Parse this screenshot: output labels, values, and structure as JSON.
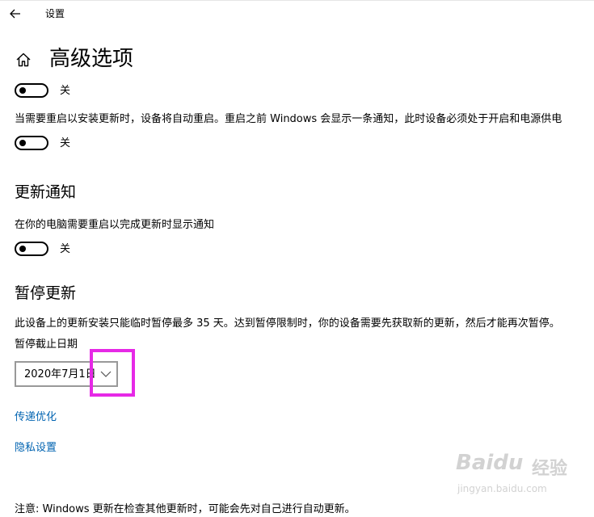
{
  "window": {
    "app_title": "设置",
    "back_icon": "arrow-left-icon"
  },
  "page": {
    "home_icon": "home-icon",
    "title": "高级选项"
  },
  "toggles": {
    "first": {
      "state_label": "关",
      "on": false
    },
    "restart": {
      "description": "当需要重启以安装更新时，设备将自动重启。重启之前 Windows 会显示一条通知，此时设备必须处于开启和电源供电",
      "state_label": "关",
      "on": false
    }
  },
  "update_notifications": {
    "heading": "更新通知",
    "description": "在你的电脑需要重启以完成更新时显示通知",
    "state_label": "关",
    "on": false
  },
  "pause_updates": {
    "heading": "暂停更新",
    "description": "此设备上的更新安装只能临时暂停最多 35 天。达到暂停限制时，你的设备需要先获取新的更新，然后才能再次暂停。",
    "date_label": "暂停截止日期",
    "selected_date": "2020年7月1日",
    "chevron_icon": "chevron-down-icon"
  },
  "links": {
    "delivery_optimization": "传递优化",
    "privacy_settings": "隐私设置"
  },
  "footer_note": "注意: Windows 更新在检查其他更新时，可能会先对自己进行自动更新。",
  "watermark": {
    "brand": "Baidu",
    "brand_suffix": "经验",
    "url": "jingyan.baidu.com"
  },
  "colors": {
    "link": "#0063b1",
    "highlight": "#e629e6",
    "toggle_off": "#000000"
  }
}
